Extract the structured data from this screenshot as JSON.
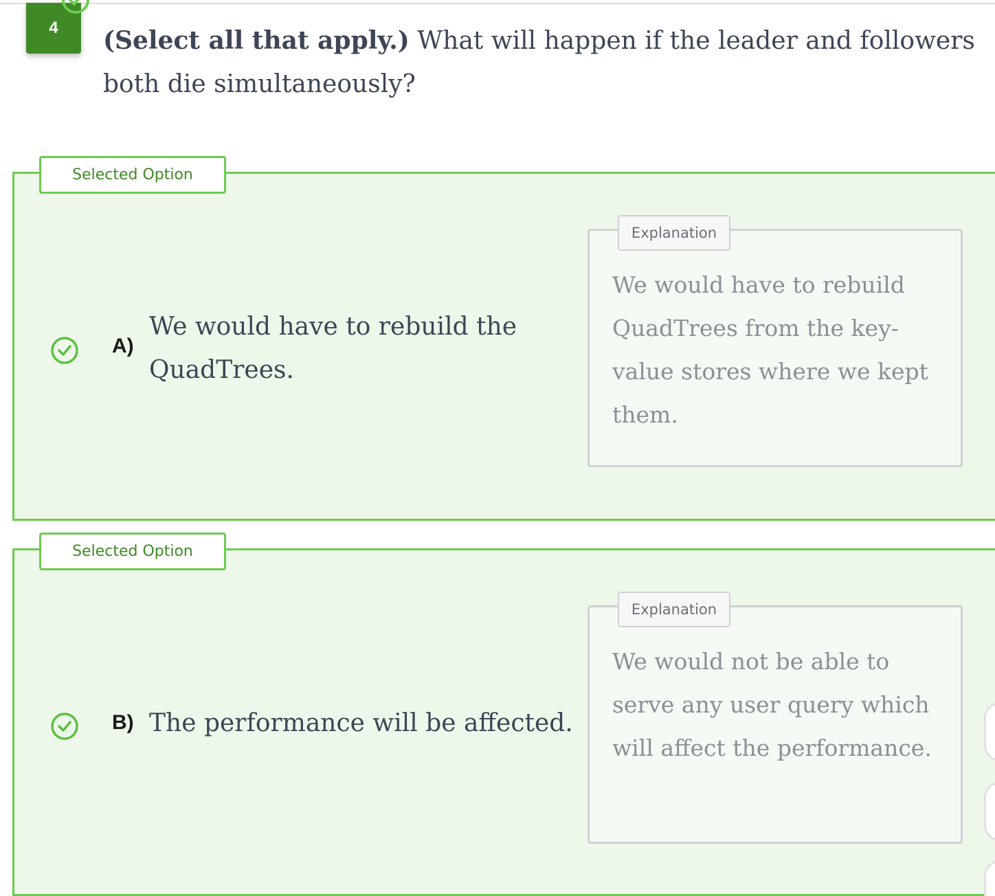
{
  "question": {
    "number": "4",
    "prefix": "(Select all that apply.)",
    "text": " What will happen if the leader and followers both die simultaneously?"
  },
  "options": [
    {
      "tag": "Selected Option",
      "letter": "A)",
      "text": "We would have to rebuild the QuadTrees.",
      "state_icon": "check-circle-icon",
      "explanation_tag": "Explanation",
      "explanation": "We would have to rebuild QuadTrees from the key-value stores where we kept them."
    },
    {
      "tag": "Selected Option",
      "letter": "B)",
      "text": "The performance will be affected.",
      "state_icon": "check-circle-icon",
      "explanation_tag": "Explanation",
      "explanation": "We would not be able to serve any user query which will affect the performance."
    }
  ],
  "colors": {
    "accent_green": "#6ccb4e",
    "dark_green": "#3f8a26",
    "selected_background": "#eef8ea",
    "explanation_border": "#cfd0d4"
  }
}
